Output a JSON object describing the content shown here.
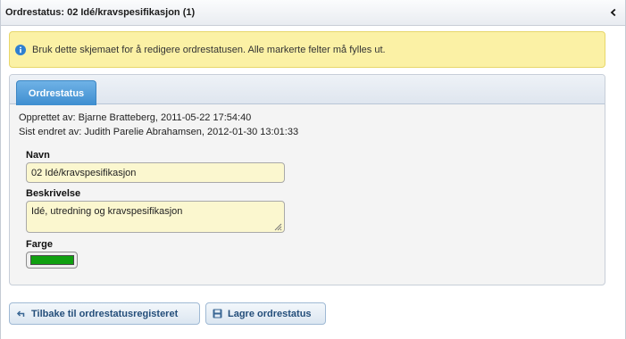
{
  "header": {
    "title": "Ordrestatus: 02 Idé/kravspesifikasjon (1)",
    "collapse_icon": "chevron-left-icon"
  },
  "info": {
    "icon": "info-icon",
    "text": "Bruk dette skjemaet for å redigere ordrestatusen. Alle markerte felter må fylles ut."
  },
  "tabs": [
    {
      "label": "Ordrestatus",
      "selected": true
    }
  ],
  "meta": {
    "created": "Opprettet av: Bjarne Bratteberg, 2011-05-22 17:54:40",
    "changed": "Sist endret av: Judith Parelie Abrahamsen, 2012-01-30 13:01:33"
  },
  "form": {
    "name_label": "Navn",
    "name_value": "02 Idé/kravspesifikasjon",
    "description_label": "Beskrivelse",
    "description_value": "Idé, utredning og kravspesifikasjon",
    "color_label": "Farge",
    "color_value": "#10a010"
  },
  "actions": {
    "back_label": "Tilbake til ordrestatusregisteret",
    "back_icon": "return-arrow-icon",
    "save_label": "Lagre ordrestatus",
    "save_icon": "save-disk-icon"
  },
  "colors": {
    "info_bg": "#fbf1a5",
    "tab_active": "#4a99d8",
    "input_bg": "#fbf7cf",
    "button_text": "#244e7a"
  }
}
